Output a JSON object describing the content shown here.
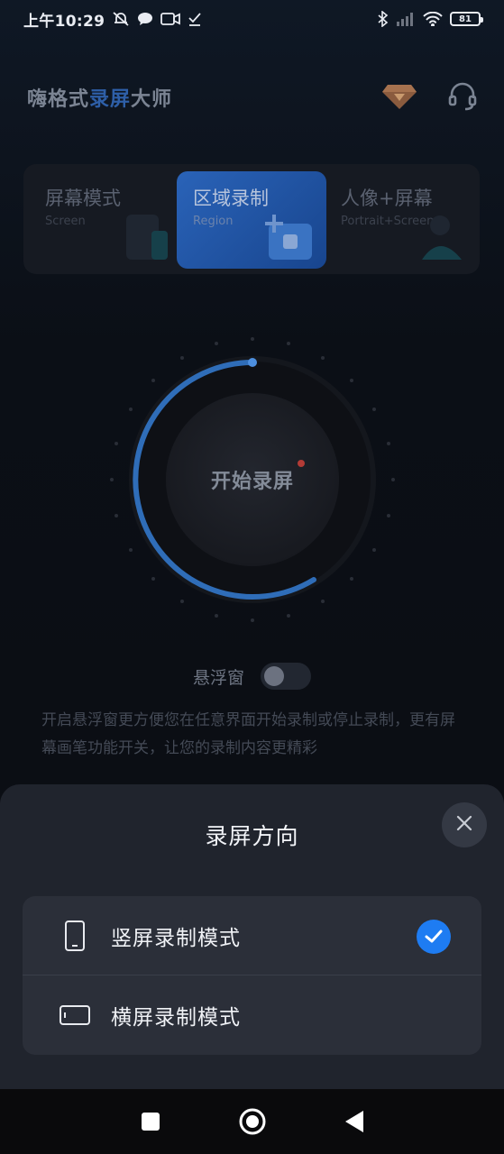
{
  "status_bar": {
    "time": "上午10:29",
    "battery": "81"
  },
  "header": {
    "title_part1": "嗨格式",
    "title_part2": "录屏",
    "title_part3": "大师",
    "icons": [
      "vip-diamond-icon",
      "headset-icon"
    ]
  },
  "modes": [
    {
      "label": "屏幕模式",
      "sub": "Screen",
      "active": false
    },
    {
      "label": "区域录制",
      "sub": "Region",
      "active": true
    },
    {
      "label": "人像+屏幕",
      "sub": "Portrait+Screen",
      "active": false
    }
  ],
  "record": {
    "label": "开始录屏"
  },
  "floating_window": {
    "label": "悬浮窗",
    "enabled": false,
    "description": "开启悬浮窗更方便您在任意界面开始录制或停止录制，更有屏幕画笔功能开关，让您的录制内容更精彩"
  },
  "sheet": {
    "title": "录屏方向",
    "options": [
      {
        "label": "竖屏录制模式",
        "icon": "portrait-phone-icon",
        "selected": true
      },
      {
        "label": "横屏录制模式",
        "icon": "landscape-phone-icon",
        "selected": false
      }
    ]
  },
  "colors": {
    "accent": "#1e7cf2",
    "sheet_bg": "#20242d",
    "card_bg": "#2b2f39",
    "active_tab": "#2a63b8"
  }
}
